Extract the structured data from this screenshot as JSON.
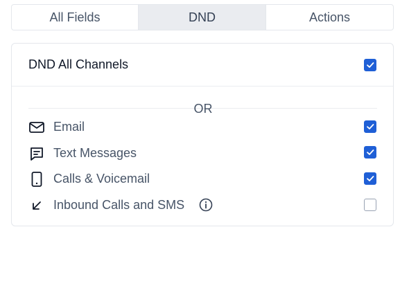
{
  "tabs": [
    {
      "label": "All Fields",
      "active": false
    },
    {
      "label": "DND",
      "active": true
    },
    {
      "label": "Actions",
      "active": false
    }
  ],
  "dnd_all": {
    "label": "DND All Channels",
    "checked": true
  },
  "separator": {
    "text": "OR"
  },
  "channels": [
    {
      "label": "Email",
      "icon": "mail-icon",
      "checked": true
    },
    {
      "label": "Text Messages",
      "icon": "message-icon",
      "checked": true
    },
    {
      "label": "Calls & Voicemail",
      "icon": "phone-icon",
      "checked": true
    },
    {
      "label": "Inbound Calls and SMS",
      "icon": "arrow-down-left-icon",
      "info_icon": "info-icon",
      "checked": false
    }
  ],
  "colors": {
    "accent": "#1f5fd6",
    "active_tab": "#eaecf0",
    "border": "#e4e7ec"
  }
}
